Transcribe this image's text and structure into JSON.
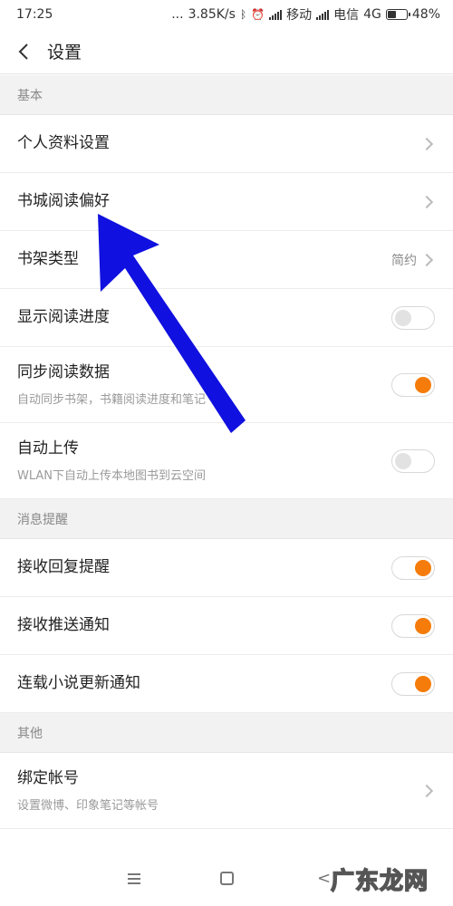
{
  "status": {
    "time": "17:25",
    "dots": "...",
    "speed": "3.85K/s",
    "carrier1": "移动",
    "carrier2": "电信",
    "network": "4G",
    "battery": "48%",
    "battery_level": 0.48
  },
  "header": {
    "title": "设置"
  },
  "sections": {
    "basic": {
      "title": "基本",
      "profile": "个人资料设置",
      "store_pref": "书城阅读偏好",
      "shelf_type": "书架类型",
      "shelf_type_value": "简约",
      "show_progress": "显示阅读进度",
      "sync": "同步阅读数据",
      "sync_sub": "自动同步书架，书籍阅读进度和笔记",
      "auto_upload": "自动上传",
      "auto_upload_sub": "WLAN下自动上传本地图书到云空间"
    },
    "notify": {
      "title": "消息提醒",
      "reply": "接收回复提醒",
      "push": "接收推送通知",
      "serial": "连载小说更新通知"
    },
    "other": {
      "title": "其他",
      "bind": "绑定帐号",
      "bind_sub": "设置微博、印象笔记等帐号"
    }
  },
  "toggles": {
    "show_progress": false,
    "sync": true,
    "auto_upload": false,
    "reply": true,
    "push": true,
    "serial": true
  },
  "colors": {
    "toggle_on": "#f57c0a",
    "annotation_arrow": "#1010e0"
  },
  "icons": {
    "back": "chevron-left-icon",
    "next": "chevron-right-icon",
    "menu": "menu-icon",
    "home": "home-icon",
    "nav_back": "back-icon"
  },
  "watermark": "广东龙网"
}
